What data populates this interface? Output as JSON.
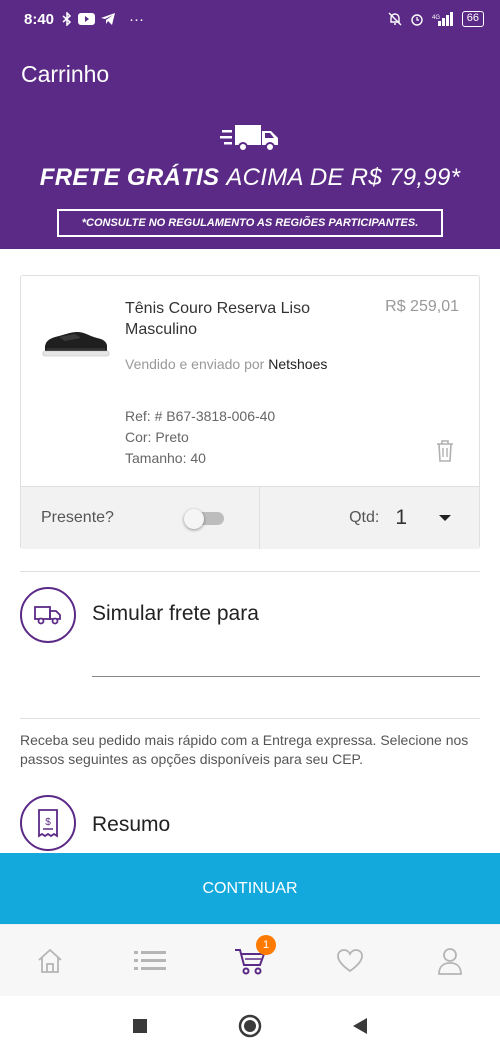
{
  "status_bar": {
    "time": "8:40",
    "battery": "66"
  },
  "app_bar": {
    "title": "Carrinho"
  },
  "banner": {
    "headline_bold": "FRETE GRÁTIS",
    "headline_rest": "ACIMA DE R$ 79,99*",
    "note": "*CONSULTE NO REGULAMENTO AS REGIÕES PARTICIPANTES."
  },
  "cart_item": {
    "name": "Tênis Couro Reserva Liso Masculino",
    "price": "R$ 259,01",
    "sold_by_prefix": "Vendido e enviado por",
    "seller": "Netshoes",
    "ref": "Ref: # B67-3818-006-40",
    "color": "Cor: Preto",
    "size": "Tamanho: 40",
    "gift_label": "Presente?",
    "qty_label": "Qtd:",
    "qty_value": "1"
  },
  "shipping": {
    "title": "Simular frete para",
    "cep_value": "",
    "info": "Receba seu pedido mais rápido com a Entrega expressa. Selecione nos passos seguintes as opções disponíveis para seu CEP."
  },
  "summary": {
    "title": "Resumo"
  },
  "continue_label": "CONTINUAR",
  "tab_bar": {
    "items": [
      "home-icon",
      "list-icon",
      "cart-icon",
      "heart-icon",
      "user-icon"
    ],
    "cart_badge": "1"
  },
  "colors": {
    "primary": "#5b2a86",
    "cta": "#14a9dc",
    "badge": "#ff7a00"
  }
}
